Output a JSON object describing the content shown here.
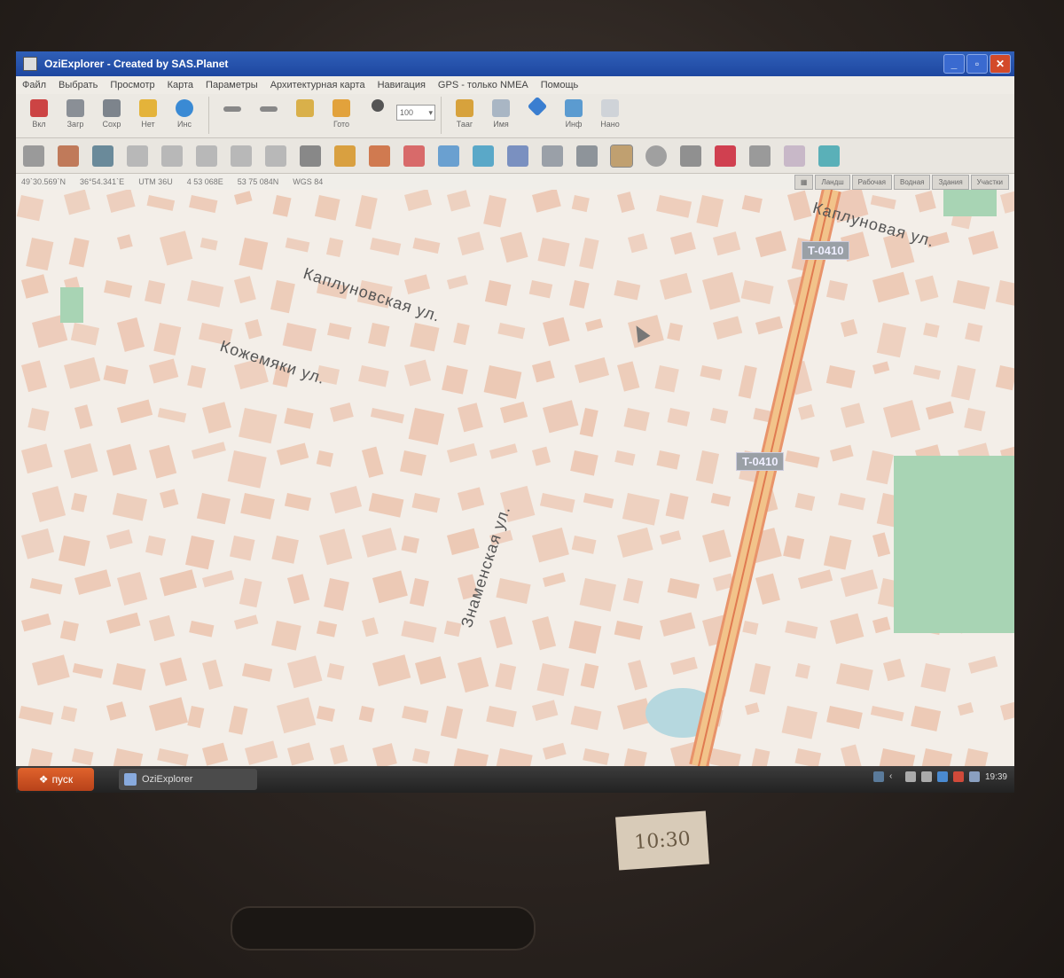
{
  "window": {
    "title": "OziExplorer - Created by SAS.Planet",
    "controls": [
      "_",
      "▫",
      "✕"
    ]
  },
  "menu": [
    "Файл",
    "Выбрать",
    "Просмотр",
    "Карта",
    "Параметры",
    "Архитектурная карта",
    "Навигация",
    "GPS - только NMEA",
    "Помощь"
  ],
  "toolbar1": {
    "buttons": [
      "Вкл",
      "Загр",
      "Сохр",
      "Нет",
      "Инс",
      "",
      "",
      "",
      "Гото",
      "Тааг",
      "Имя",
      "",
      "Инф",
      "Нано"
    ],
    "zoom_value": "100"
  },
  "statusbar": {
    "coords": [
      "49`30.569`N",
      "36°54.341`E",
      "UTM 36U",
      "4 53 068E",
      "53 75 084N",
      "WGS 84"
    ],
    "layer_tabs": [
      "Ландш",
      "Рабочая",
      "Водная",
      "Здания",
      "Участки"
    ]
  },
  "map": {
    "street_labels": [
      "Каплуновская ул.",
      "Кожемяки ул.",
      "Знаменская ул.",
      "Каплуновая ул."
    ],
    "road_shields": [
      "T-0410",
      "T-0410"
    ],
    "colors": {
      "background": "#f3eee8",
      "buildings": "#ecc8b4",
      "park": "#a8d4b4",
      "main_road": "#f2c38a",
      "road_edge": "#e8936a",
      "water": "#b6d8df"
    }
  },
  "taskbar": {
    "start_label": "пуск",
    "task_label": "OziExplorer",
    "clock": "19:39"
  },
  "sticker_text": "10:30"
}
